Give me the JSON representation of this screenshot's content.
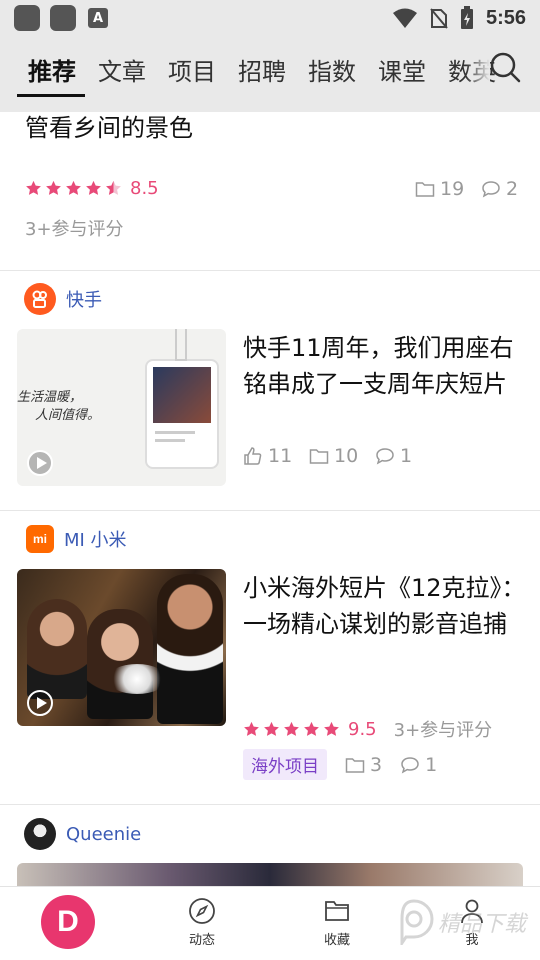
{
  "status_bar": {
    "time": "5:56",
    "a_icon_letter": "A"
  },
  "tabs": [
    "推荐",
    "文章",
    "项目",
    "招聘",
    "指数",
    "课堂",
    "数英"
  ],
  "cards": {
    "first": {
      "title": "管看乡间的景色",
      "rating": {
        "stars": 4.5,
        "score": "8.5"
      },
      "favorites": "19",
      "comments": "2",
      "participants": "3+参与评分"
    },
    "kuaishou": {
      "source": "快手",
      "title": "快手11周年，我们用座右铭串成了一支周年庆短片",
      "likes": "11",
      "favorites": "10",
      "comments": "1",
      "thumb_text_1": "生活温暖，",
      "thumb_text_2": "人间值得。"
    },
    "xiaomi": {
      "source": "MI 小米",
      "logo": "mi",
      "title": "小米海外短片《12克拉》：一场精心谋划的影音追捕",
      "rating": {
        "stars": 5,
        "score": "9.5"
      },
      "participants": "3+参与评分",
      "tag": "海外项目",
      "favorites": "3",
      "comments": "1"
    },
    "queenie": {
      "source": "Queenie"
    }
  },
  "bottom_nav": {
    "home_letter": "D",
    "items": [
      "动态",
      "收藏",
      "我"
    ]
  },
  "watermark": "精品下载",
  "colors": {
    "accent": "#e8366e",
    "rating": "#e84a78",
    "source_link": "#3b5bb5",
    "tag_bg": "#f1e9fb",
    "tag_text": "#7a3fc6"
  }
}
